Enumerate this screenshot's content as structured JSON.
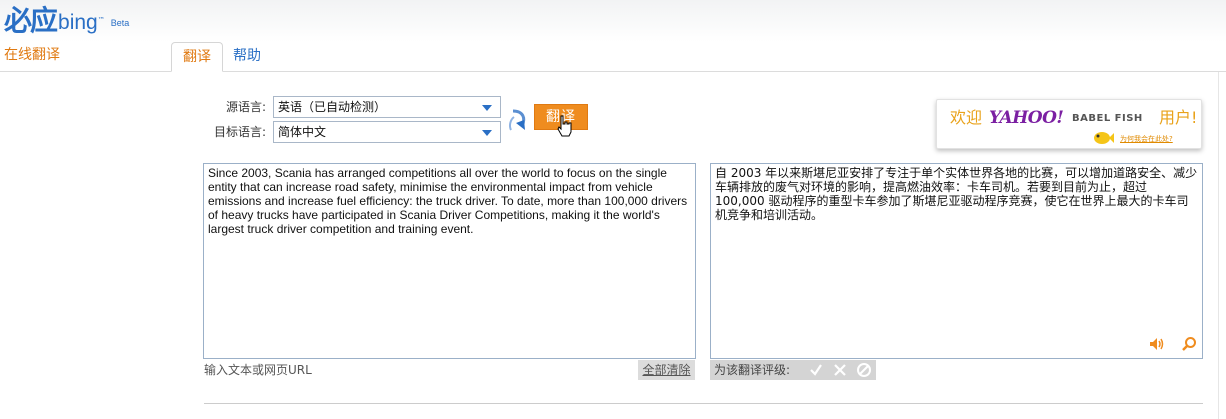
{
  "logo": {
    "brand_cn": "必应",
    "brand_bing": "bing",
    "trademark": "™",
    "beta": "Beta"
  },
  "header": {
    "service_title": "在线翻译"
  },
  "tabs": [
    {
      "label": "翻译",
      "active": true
    },
    {
      "label": "帮助",
      "active": false
    }
  ],
  "languages": {
    "source_label": "源语言:",
    "source_value": "英语（已自动检测）",
    "target_label": "目标语言:",
    "target_value": "简体中文"
  },
  "translate_button": "翻译",
  "yahoo_banner": {
    "welcome": "欢迎",
    "brand": "YAHOO!",
    "product": "BABEL FISH",
    "user": "用户!",
    "link": "为何我会在此处?"
  },
  "source": {
    "text": "Since 2003, Scania has arranged competitions all over the world to focus on the single entity that can increase road safety, minimise the environmental impact from vehicle emissions and increase fuel efficiency: the truck driver. To date, more than 100,000 drivers of heavy trucks have participated in Scania Driver Competitions, making it the world's largest truck driver competition and training event.",
    "hint": "输入文本或网页URL",
    "clear_label": "全部清除"
  },
  "target": {
    "text": "自 2003 年以来斯堪尼亚安排了专注于单个实体世界各地的比赛，可以增加道路安全、减少车辆排放的废气对环境的影响，提高燃油效率：卡车司机。若要到目前为止，超过 100,000 驱动程序的重型卡车参加了斯堪尼亚驱动程序竞赛，使它在世界上最大的卡车司机竞争和培训活动。",
    "rating_label": "为该翻译评级:"
  },
  "colors": {
    "accent_orange": "#ef8c1f",
    "link_blue": "#2a6fc5",
    "yahoo_purple": "#7b1fa2"
  }
}
